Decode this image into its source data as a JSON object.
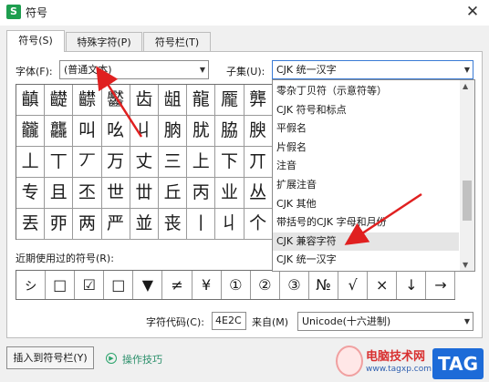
{
  "window": {
    "title": "符号",
    "app_icon": "S",
    "close": "✕"
  },
  "tabs": [
    {
      "label": "符号(S)"
    },
    {
      "label": "特殊字符(P)"
    },
    {
      "label": "符号栏(T)"
    }
  ],
  "font": {
    "label": "字体(F):",
    "value": "(普通文本)"
  },
  "subset": {
    "label": "子集(U):",
    "value": "CJK 统一汉字"
  },
  "grid": [
    [
      "齻",
      "齼",
      "齽",
      "齾",
      "齿",
      "龃",
      "龍",
      "龎",
      "龏",
      "龒"
    ],
    [
      "龖",
      "龘",
      "叫",
      "吆",
      "丩",
      "朒",
      "肬",
      "脇",
      "腴",
      "膇"
    ],
    [
      "丄",
      "丅",
      "丆",
      "万",
      "丈",
      "三",
      "上",
      "下",
      "丌",
      "不"
    ],
    [
      "专",
      "且",
      "丕",
      "世",
      "丗",
      "丘",
      "丙",
      "业",
      "丛",
      "东"
    ],
    [
      "丟",
      "丣",
      "两",
      "严",
      "並",
      "丧",
      "丨",
      "丩",
      "个",
      "丫"
    ]
  ],
  "dropdown": {
    "options": [
      "零杂丁贝符（示意符等）",
      "CJK 符号和标点",
      "平假名",
      "片假名",
      "注音",
      "扩展注音",
      "CJK 其他",
      "带括号的CJK 字母和月份",
      "CJK 兼容字符",
      "CJK 统一汉字"
    ],
    "highlighted_index": 8
  },
  "recent": {
    "label": "近期使用过的符号(R):",
    "symbols": [
      "ㇱ",
      "□",
      "☑",
      "□",
      "▼",
      "≠",
      "¥",
      "①",
      "②",
      "③",
      "№",
      "√",
      "×",
      "↓",
      "→"
    ]
  },
  "code": {
    "label": "字符代码(C):",
    "value": "4E2C"
  },
  "from": {
    "label": "来自(M)",
    "value": "Unicode(十六进制)"
  },
  "buttons": {
    "insert": "插入到符号栏(Y)",
    "tips": "操作技巧"
  },
  "watermark": {
    "line1": "电脑技术网",
    "line2": "www.tagxp.com",
    "tag": "TAG"
  },
  "colors": {
    "accent": "#3a7bd5",
    "arrow": "#e02020",
    "tips": "#2a8f6a"
  }
}
